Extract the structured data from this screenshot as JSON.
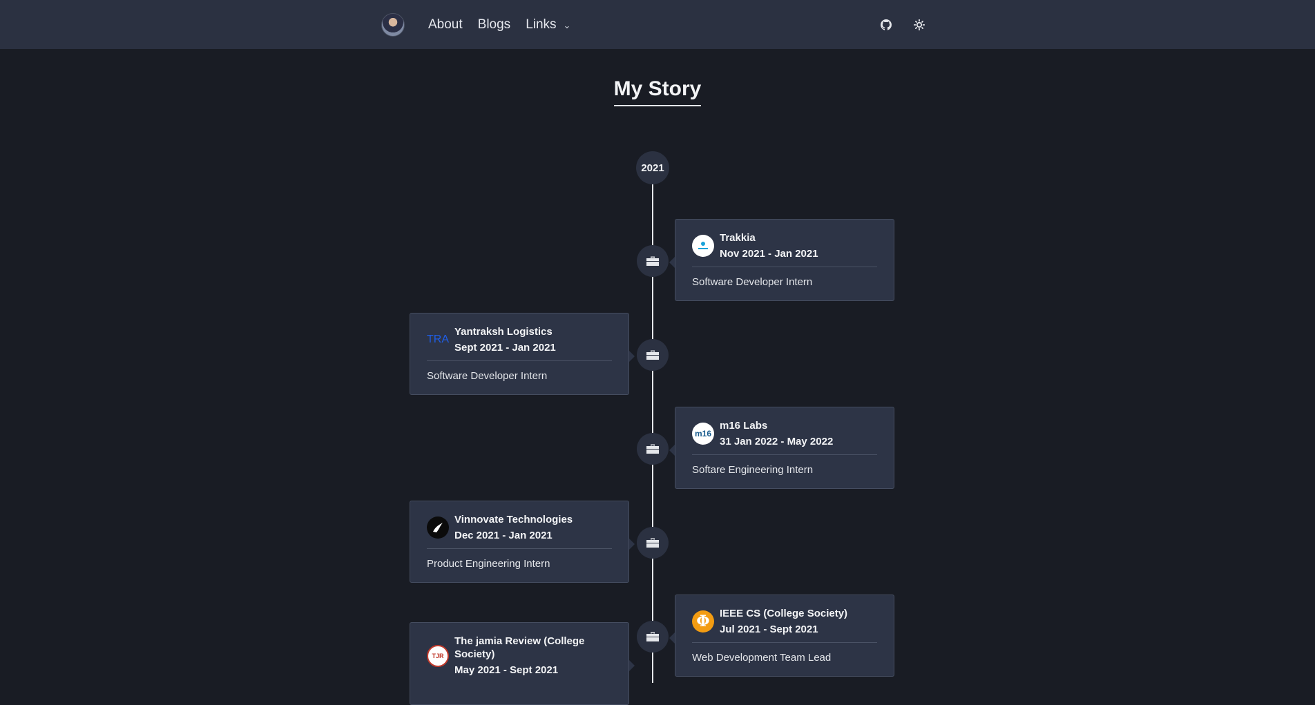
{
  "nav": {
    "avatar_alt": "profile avatar",
    "links": [
      "About",
      "Blogs",
      "Links"
    ],
    "github_icon": "github-icon",
    "theme_icon": "sun-icon"
  },
  "page": {
    "title": "My Story"
  },
  "timeline": {
    "year": "2021",
    "entries": [
      {
        "company": "Trakkia",
        "date": "Nov 2021 - Jan 2021",
        "role": "Software Developer Intern",
        "side": "right",
        "logo_icon": "trakkia-logo"
      },
      {
        "company": "Yantraksh Logistics",
        "date": "Sept 2021 - Jan 2021",
        "role": "Software Developer Intern",
        "side": "left",
        "logo_icon": "yantraksh-logo",
        "logo_text": "TRA"
      },
      {
        "company": "m16 Labs",
        "date": "31 Jan 2022 - May 2022",
        "role": "Softare Engineering Intern",
        "side": "right",
        "logo_icon": "m16-labs-logo",
        "logo_text": "m16"
      },
      {
        "company": "Vinnovate Technologies",
        "date": "Dec 2021 - Jan 2021",
        "role": "Product Engineering Intern",
        "side": "left",
        "logo_icon": "vinnovate-logo"
      },
      {
        "company": "IEEE CS (College Society)",
        "date": "Jul 2021 - Sept 2021",
        "role": "Web Development Team Lead",
        "side": "right",
        "logo_icon": "ieee-cs-logo",
        "logo_text": "Φ"
      },
      {
        "company": "The jamia Review (College Society)",
        "date": "May 2021 - Sept 2021",
        "role": "",
        "side": "left",
        "logo_icon": "jamia-review-logo",
        "logo_text": "TJR"
      }
    ]
  }
}
